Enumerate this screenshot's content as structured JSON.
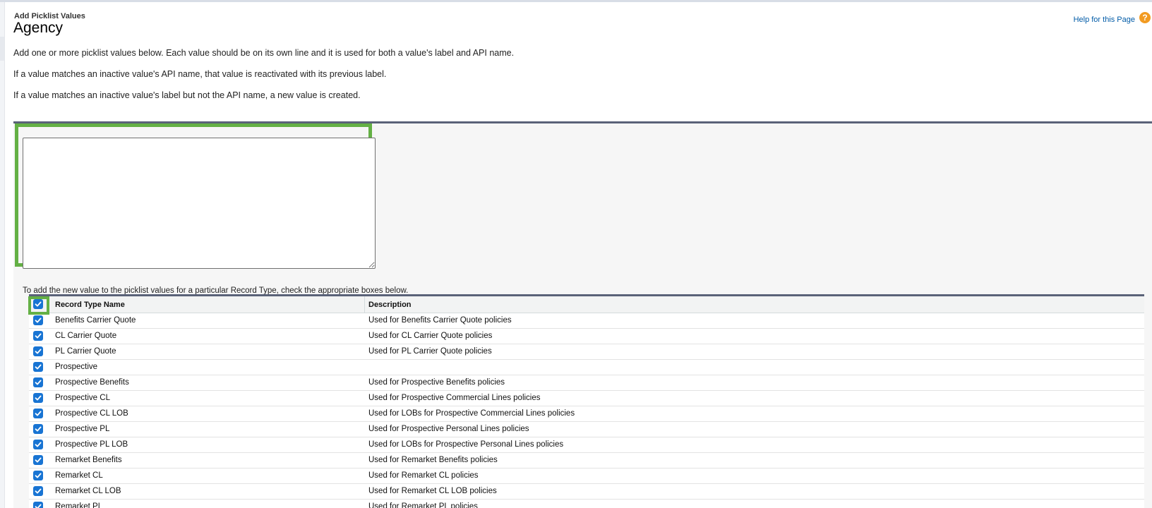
{
  "page": {
    "subtitle": "Add Picklist Values",
    "title": "Agency",
    "help_link": "Help for this Page",
    "help_icon": "?"
  },
  "intro": {
    "line1": "Add one or more picklist values below. Each value should be on its own line and it is used for both a value's label and API name.",
    "line2": "If a value matches an inactive value's API name, that value is reactivated with its previous label.",
    "line3": "If a value matches an inactive value's label but not the API name, a new value is created."
  },
  "values_input": {
    "value": "",
    "placeholder": ""
  },
  "instruction": "To add the new value to the picklist values for a particular Record Type, check the appropriate boxes below.",
  "table": {
    "headers": {
      "name": "Record Type Name",
      "description": "Description"
    },
    "select_all_checked": true,
    "rows": [
      {
        "name": "Benefits Carrier Quote",
        "description": "Used for Benefits Carrier Quote policies",
        "checked": true
      },
      {
        "name": "CL Carrier Quote",
        "description": "Used for CL Carrier Quote policies",
        "checked": true
      },
      {
        "name": "PL Carrier Quote",
        "description": "Used for PL Carrier Quote policies",
        "checked": true
      },
      {
        "name": "Prospective",
        "description": "",
        "checked": true
      },
      {
        "name": "Prospective Benefits",
        "description": "Used for Prospective Benefits policies",
        "checked": true
      },
      {
        "name": "Prospective CL",
        "description": "Used for Prospective Commercial Lines policies",
        "checked": true
      },
      {
        "name": "Prospective CL LOB",
        "description": "Used for LOBs for Prospective Commercial Lines policies",
        "checked": true
      },
      {
        "name": "Prospective PL",
        "description": "Used for Prospective Personal Lines policies",
        "checked": true
      },
      {
        "name": "Prospective PL LOB",
        "description": "Used for LOBs for Prospective Personal Lines policies",
        "checked": true
      },
      {
        "name": "Remarket Benefits",
        "description": "Used for Remarket Benefits policies",
        "checked": true
      },
      {
        "name": "Remarket CL",
        "description": "Used for Remarket CL policies",
        "checked": true
      },
      {
        "name": "Remarket CL LOB",
        "description": "Used for Remarket CL LOB policies",
        "checked": true
      },
      {
        "name": "Remarket PL",
        "description": "Used for Remarket PL policies",
        "checked": true
      }
    ]
  },
  "colors": {
    "highlight": "#64b045",
    "checkbox": "#1874d3",
    "link": "#015ba7",
    "help_icon": "#f29b22",
    "panel_border": "#5a6278"
  },
  "icons": {
    "help": "help-circle-icon",
    "check": "checkmark-icon",
    "resize": "resize-grip-icon"
  }
}
